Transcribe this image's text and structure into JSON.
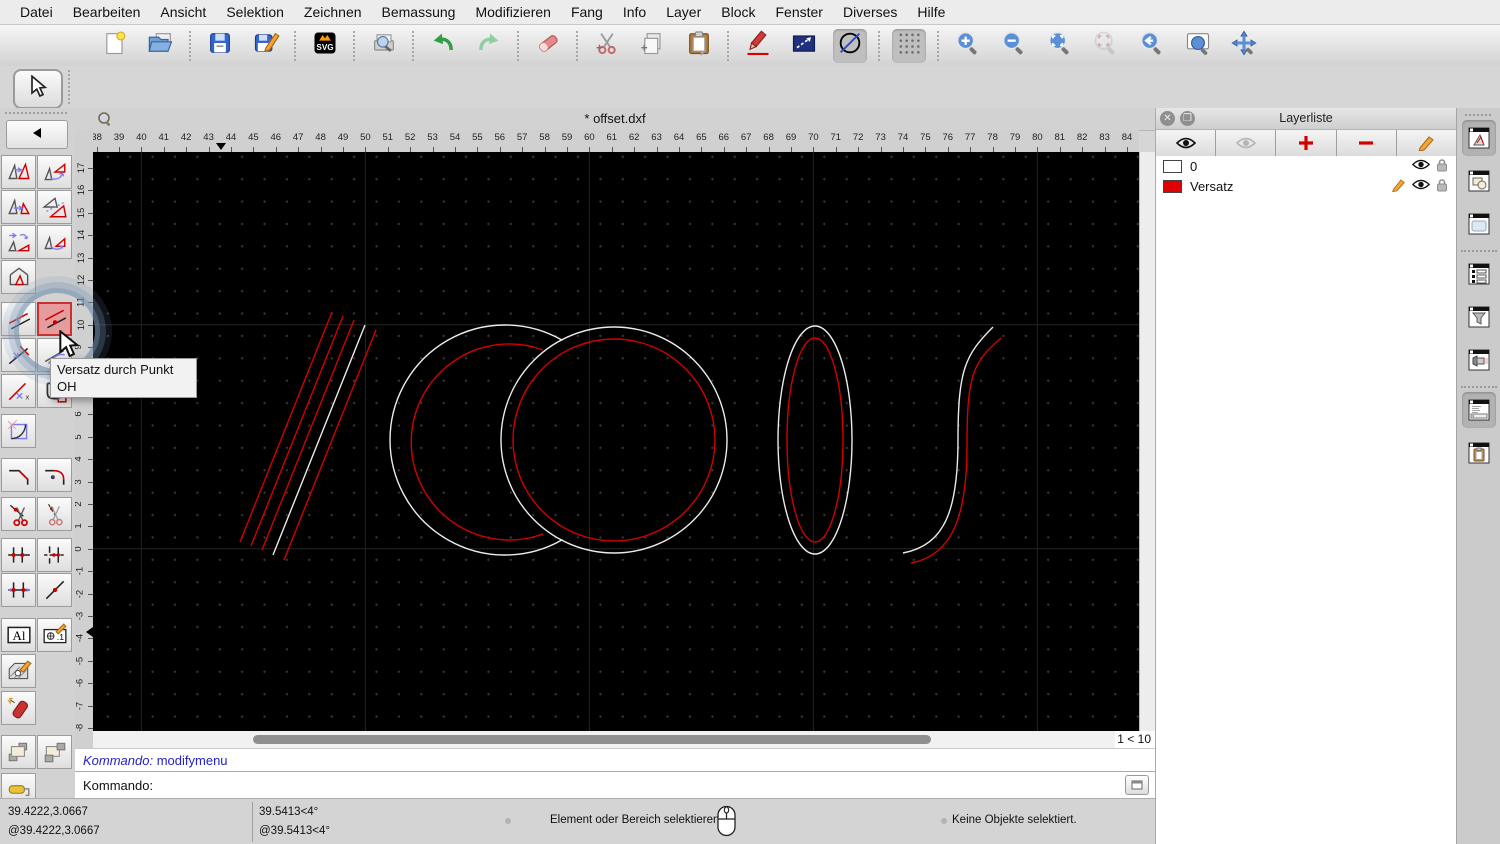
{
  "app": {
    "title": "* offset.dxf",
    "grid_indicator": "1 < 10"
  },
  "menu": {
    "items": [
      "Datei",
      "Bearbeiten",
      "Ansicht",
      "Selektion",
      "Zeichnen",
      "Bemassung",
      "Modifizieren",
      "Fang",
      "Info",
      "Layer",
      "Block",
      "Fenster",
      "Diverses",
      "Hilfe"
    ]
  },
  "tooltip": {
    "title": "Versatz durch Punkt",
    "shortcut": "OH"
  },
  "rulers": {
    "h_min": 38,
    "h_max": 84,
    "v_min": -8,
    "v_max": 17
  },
  "layer_panel": {
    "title": "Layerliste",
    "layers": [
      {
        "name": "0",
        "color": "#ffffff",
        "has_pencil": false
      },
      {
        "name": "Versatz",
        "color": "#e00000",
        "has_pencil": true
      }
    ]
  },
  "command": {
    "history_label": "Kommando:",
    "history_value": "modifymenu",
    "prompt_label": "Kommando:",
    "input_value": ""
  },
  "status": {
    "coord_abs": "39.4222,3.0667",
    "coord_rel": "@39.4222,3.0667",
    "polar_abs": "39.5413<4°",
    "polar_rel": "@39.5413<4°",
    "hint": "Element oder Bereich selektieren",
    "selection_info": "Keine Objekte selektiert."
  },
  "colors": {
    "accent_red": "#e00000",
    "command_blue": "#2222cc",
    "line_white": "#ebebeb",
    "line_red": "#d40000"
  }
}
